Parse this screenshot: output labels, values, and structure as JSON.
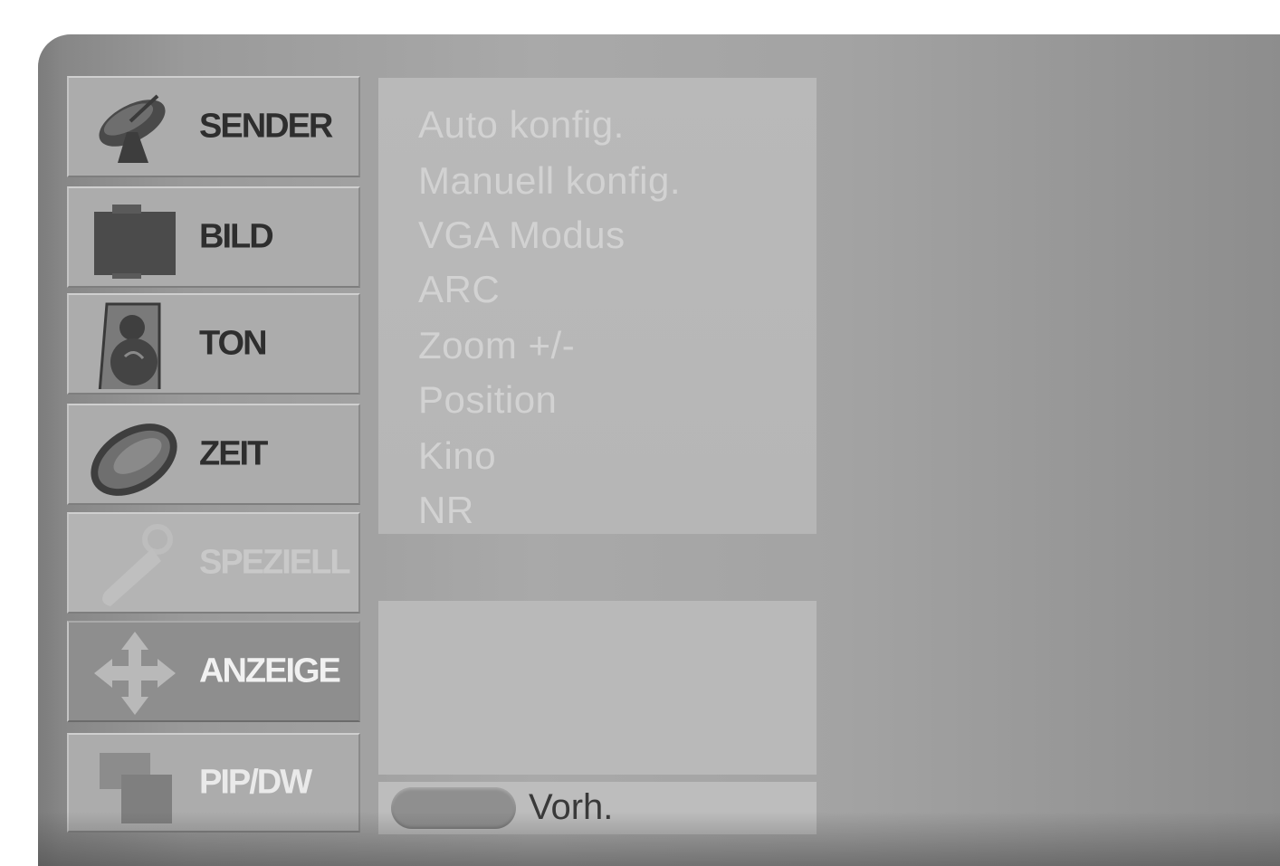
{
  "sidebar": {
    "items": [
      {
        "label": "SENDER",
        "icon": "satellite-dish-icon",
        "state": "normal"
      },
      {
        "label": "BILD",
        "icon": "picture-icon",
        "state": "normal"
      },
      {
        "label": "TON",
        "icon": "speaker-icon",
        "state": "normal"
      },
      {
        "label": "ZEIT",
        "icon": "clock-icon",
        "state": "normal"
      },
      {
        "label": "SPEZIELL",
        "icon": "key-tag-icon",
        "state": "dim"
      },
      {
        "label": "ANZEIGE",
        "icon": "move-arrows-icon",
        "state": "selected"
      },
      {
        "label": "PIP/DW",
        "icon": "pip-windows-icon",
        "state": "faded"
      }
    ]
  },
  "submenu": {
    "items": [
      "Auto konfig.",
      "Manuell konfig.",
      "VGA Modus",
      "ARC",
      "Zoom +/-",
      "Position",
      "Kino",
      "NR"
    ]
  },
  "footer": {
    "key_label": "Vorh.",
    "key_icon": "colored-key-icon"
  },
  "colors": {
    "menu_background": "#a9a9a9",
    "selected_item": "#8e8e8e",
    "inactive_text": "#d2d2d2"
  }
}
